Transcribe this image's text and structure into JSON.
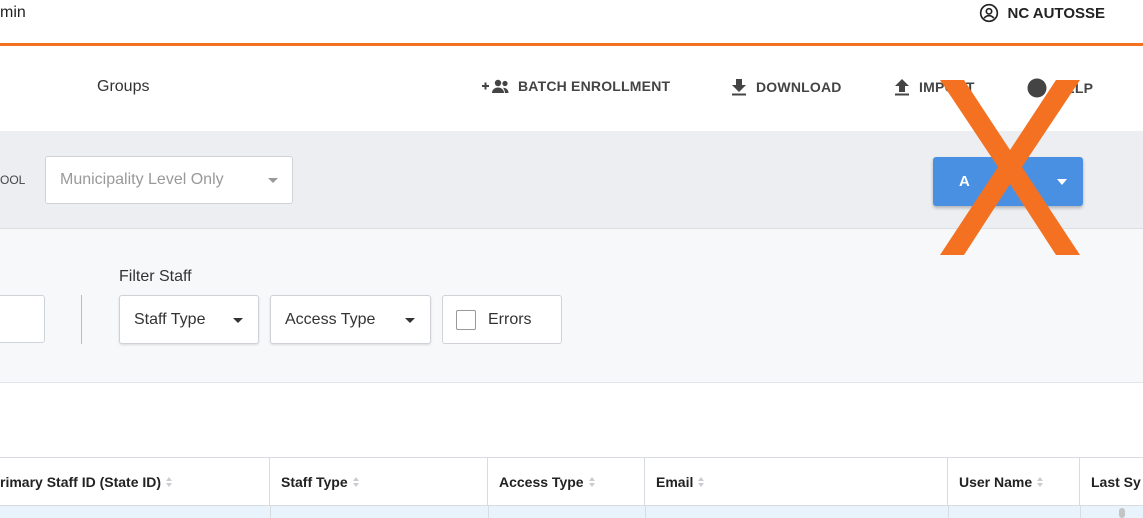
{
  "header": {
    "app_title_fragment": "min",
    "user_name": "NC AUTOSSE"
  },
  "nav": {
    "groups_label": "Groups",
    "batch_enrollment": "BATCH ENROLLMENT",
    "download": "DOWNLOAD",
    "import": "IMPORT",
    "help": "HELP"
  },
  "school_select": {
    "label_fragment": "OOL",
    "value": "Municipality Level Only"
  },
  "add_button": {
    "visible_text": "A"
  },
  "filter": {
    "title": "Filter Staff",
    "staff_type": "Staff Type",
    "access_type": "Access Type",
    "errors": "Errors"
  },
  "table": {
    "columns": [
      "rimary Staff ID (State ID)",
      "Staff Type",
      "Access Type",
      "Email",
      "User Name",
      "Last Sy"
    ]
  },
  "colors": {
    "accent_orange": "#f37121",
    "primary_blue": "#4a90e2",
    "band_gray": "#eceef1"
  }
}
